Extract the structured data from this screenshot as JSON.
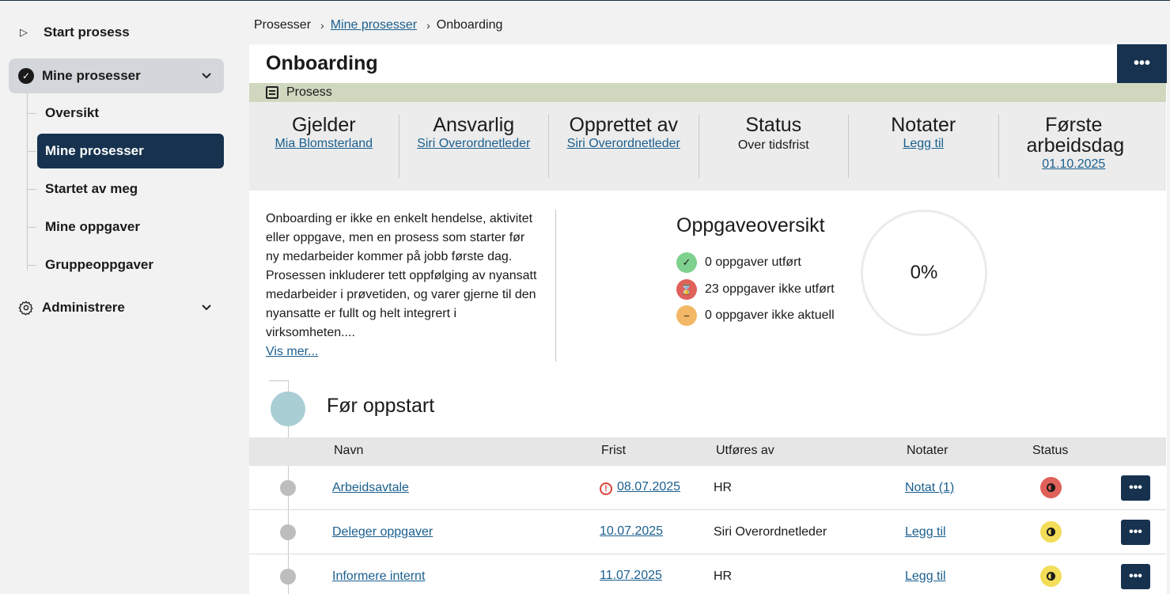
{
  "sidebar": {
    "start_label": "Start prosess",
    "group_label": "Mine prosesser",
    "items": [
      {
        "label": "Oversikt"
      },
      {
        "label": "Mine prosesser"
      },
      {
        "label": "Startet av meg"
      },
      {
        "label": "Mine oppgaver"
      },
      {
        "label": "Gruppeoppgaver"
      }
    ],
    "admin_label": "Administrere"
  },
  "breadcrumb": {
    "root": "Prosesser",
    "parent": "Mine prosesser",
    "current": "Onboarding"
  },
  "process": {
    "title": "Onboarding",
    "more": "•••",
    "type_label": "Prosess",
    "info": [
      {
        "heading": "Gjelder",
        "value": "Mia Blomsterland",
        "link": true
      },
      {
        "heading": "Ansvarlig",
        "value": "Siri Overordnetleder",
        "link": true
      },
      {
        "heading": "Opprettet av",
        "value": "Siri Overordnetleder",
        "link": true
      },
      {
        "heading": "Status",
        "value": "Over tidsfrist",
        "link": false
      },
      {
        "heading": "Notater",
        "value": "Legg til",
        "link": true
      },
      {
        "heading": "Første arbeidsdag",
        "value": "01.10.2025",
        "link": true
      }
    ],
    "description": "Onboarding er ikke en enkelt hendelse, aktivitet eller oppgave, men en prosess som starter før ny medarbeider kommer på jobb første dag. Prosessen inkluderer tett oppfølging av nyansatt medarbeider i prøvetiden, og varer gjerne til den nyansatte er fullt og helt integrert i virksomheten....",
    "show_more": "Vis mer..."
  },
  "overview": {
    "title": "Oppgaveoversikt",
    "done": "0 oppgaver utført",
    "not_done": "23 oppgaver ikke utført",
    "not_relevant": "0 oppgaver ikke aktuell",
    "percent": "0%",
    "colors": {
      "done": "#7ed08e",
      "not_done": "#e0605a",
      "not_relevant": "#f2b866"
    }
  },
  "phase": {
    "title": "Før oppstart",
    "columns": {
      "name": "Navn",
      "deadline": "Frist",
      "performer": "Utføres av",
      "notes": "Notater",
      "status": "Status"
    },
    "rows": [
      {
        "name": "Arbeidsavtale",
        "deadline": "08.07.2025",
        "overdue": true,
        "performer": "HR",
        "notes": "Notat (1)",
        "status_color": "#e0605a"
      },
      {
        "name": "Deleger oppgaver",
        "deadline": "10.07.2025",
        "overdue": false,
        "performer": "Siri Overordnetleder",
        "notes": "Legg til",
        "status_color": "#f3dd59"
      },
      {
        "name": "Informere internt",
        "deadline": "11.07.2025",
        "overdue": false,
        "performer": "HR",
        "notes": "Legg til",
        "status_color": "#f3dd59"
      }
    ],
    "row_more": "•••"
  }
}
